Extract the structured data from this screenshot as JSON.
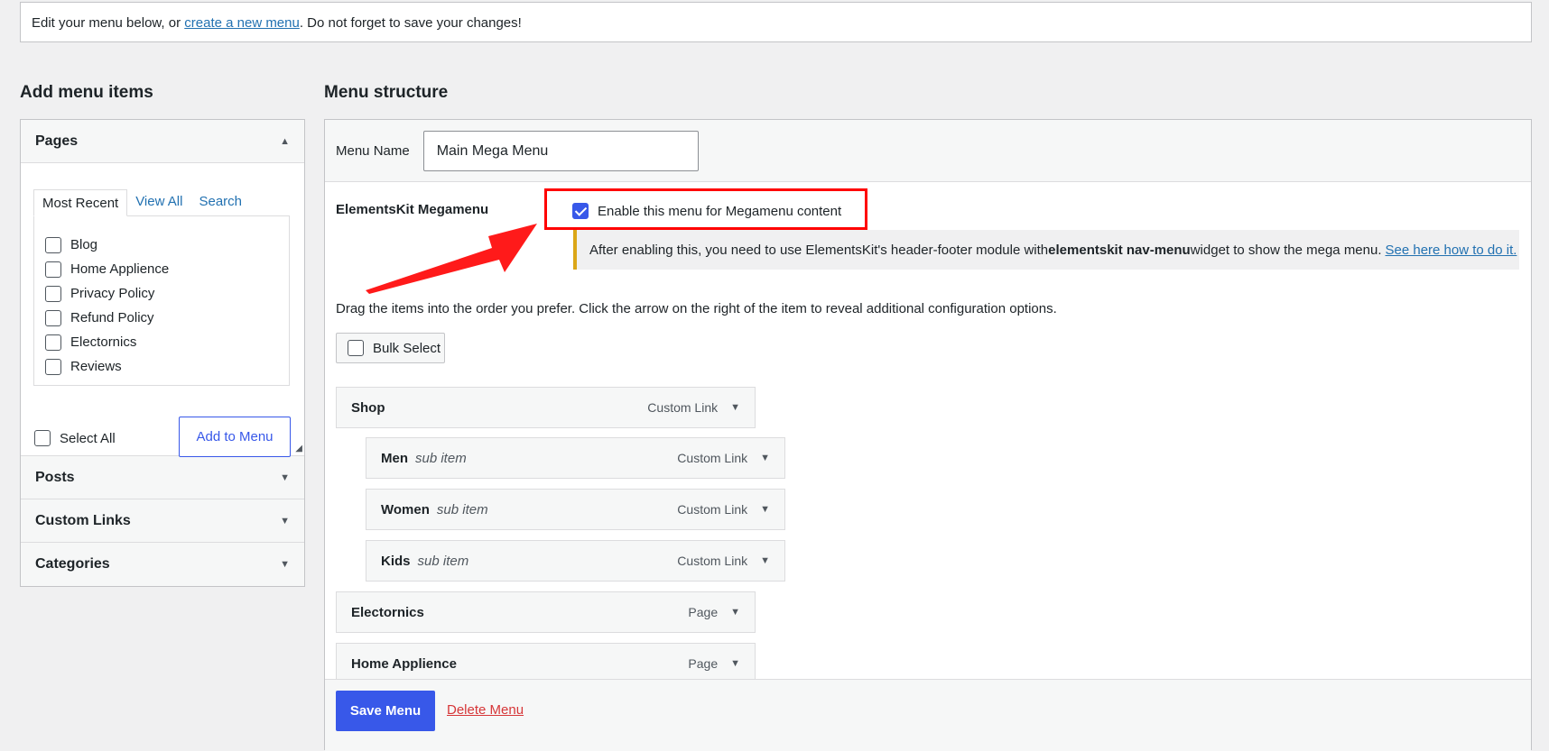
{
  "notice": {
    "before": "Edit your menu below, or ",
    "link": "create a new menu",
    "after": ". Do not forget to save your changes!"
  },
  "left": {
    "heading": "Add menu items",
    "pages": {
      "title": "Pages",
      "tabs": [
        "Most Recent",
        "View All",
        "Search"
      ],
      "items": [
        "Blog",
        "Home Applience",
        "Privacy Policy",
        "Refund Policy",
        "Electornics",
        "Reviews"
      ],
      "select_all": "Select All",
      "add_button": "Add to Menu"
    },
    "sections": [
      "Posts",
      "Custom Links",
      "Categories"
    ]
  },
  "right": {
    "heading": "Menu structure",
    "menu_name_label": "Menu Name",
    "menu_name_value": "Main Mega Menu",
    "megamenu_label": "ElementsKit Megamenu",
    "enable_label": "Enable this menu for Megamenu content",
    "info": {
      "before": "After enabling this, you need to use ElementsKit's header-footer module with ",
      "bold": "elementskit nav-menu",
      "after": " widget to show the mega menu.",
      "link": "See here how to do it."
    },
    "drag_text": "Drag the items into the order you prefer. Click the arrow on the right of the item to reveal additional configuration options.",
    "bulk_select": "Bulk Select",
    "items": [
      {
        "title": "Shop",
        "sub": "",
        "type": "Custom Link"
      },
      {
        "title": "Men",
        "sub": "sub item",
        "type": "Custom Link"
      },
      {
        "title": "Women",
        "sub": "sub item",
        "type": "Custom Link"
      },
      {
        "title": "Kids",
        "sub": "sub item",
        "type": "Custom Link"
      },
      {
        "title": "Electornics",
        "sub": "",
        "type": "Page"
      },
      {
        "title": "Home Applience",
        "sub": "",
        "type": "Page"
      }
    ],
    "save_button": "Save Menu",
    "delete_link": "Delete Menu"
  },
  "colors": {
    "accent": "#3858e9",
    "highlight": "#ff0000",
    "warning_border": "#dba617"
  }
}
